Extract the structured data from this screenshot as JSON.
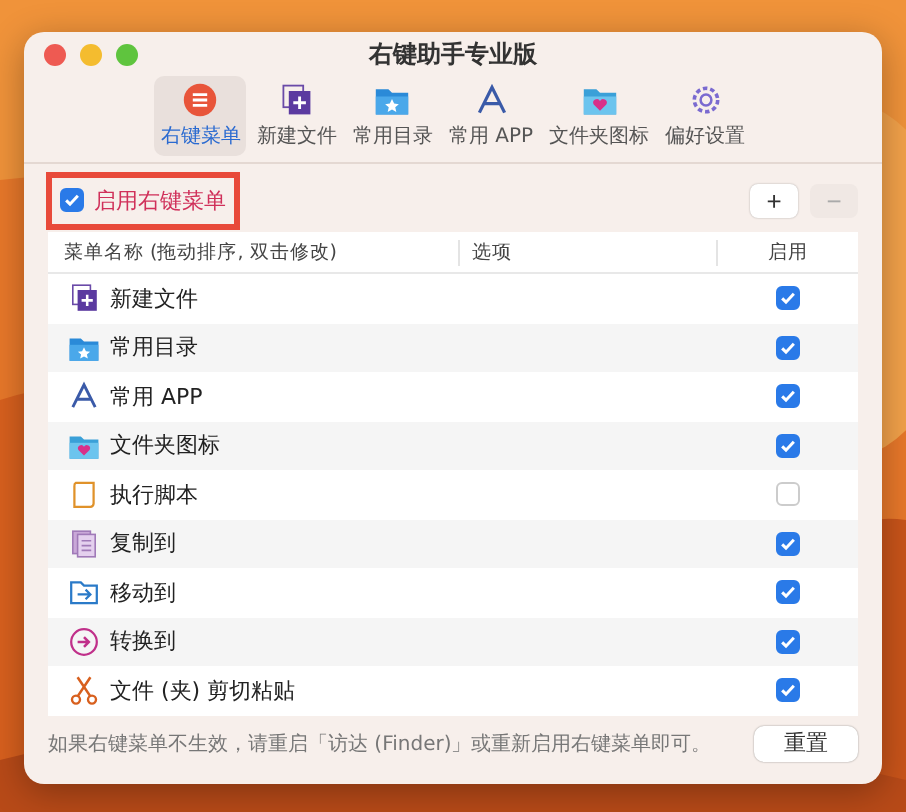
{
  "window": {
    "title": "右键助手专业版"
  },
  "toolbar": [
    {
      "label": "右键菜单",
      "kind": "menu",
      "selected": true
    },
    {
      "label": "新建文件",
      "kind": "doc-plus",
      "selected": false
    },
    {
      "label": "常用目录",
      "kind": "folder-star",
      "selected": false
    },
    {
      "label": "常用 APP",
      "kind": "app",
      "selected": false
    },
    {
      "label": "文件夹图标",
      "kind": "folder-heart",
      "selected": false
    },
    {
      "label": "偏好设置",
      "kind": "gear",
      "selected": false
    }
  ],
  "enable": {
    "label": "启用右键菜单",
    "checked": true
  },
  "add_button": "+",
  "remove_button": "−",
  "table": {
    "columns": [
      "菜单名称 (拖动排序, 双击修改)",
      "选项",
      "启用"
    ],
    "rows": [
      {
        "name": "新建文件",
        "kind": "doc-plus",
        "checked": true
      },
      {
        "name": "常用目录",
        "kind": "folder-star",
        "checked": true
      },
      {
        "name": "常用 APP",
        "kind": "app",
        "checked": true
      },
      {
        "name": "文件夹图标",
        "kind": "folder-heart",
        "checked": true
      },
      {
        "name": "执行脚本",
        "kind": "script",
        "checked": false
      },
      {
        "name": "复制到",
        "kind": "copy",
        "checked": true
      },
      {
        "name": "移动到",
        "kind": "move",
        "checked": true
      },
      {
        "name": "转换到",
        "kind": "convert",
        "checked": true
      },
      {
        "name": "文件 (夹) 剪切粘贴",
        "kind": "scissors",
        "checked": true
      }
    ]
  },
  "footer": {
    "note": "如果右键菜单不生效，请重启「访达 (Finder)」或重新启用右键菜单即可。",
    "button": "重置"
  }
}
